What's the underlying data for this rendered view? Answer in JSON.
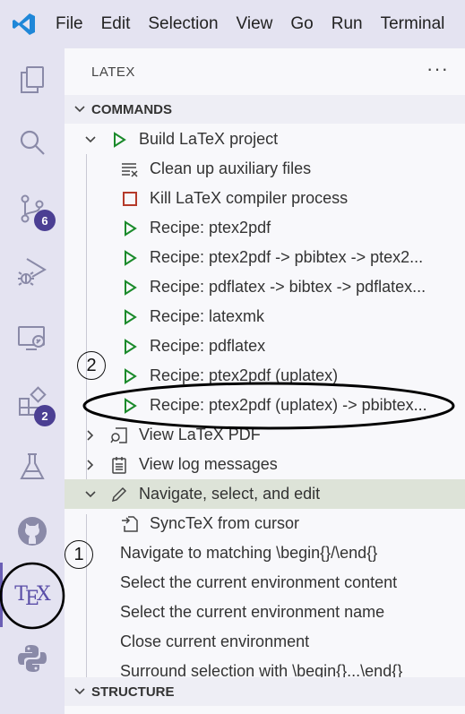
{
  "menubar": {
    "items": [
      "File",
      "Edit",
      "Selection",
      "View",
      "Go",
      "Run",
      "Terminal"
    ]
  },
  "activitybar": {
    "source_control_badge": "6",
    "extensions_badge": "2",
    "tex_label": "TEX"
  },
  "sidebar": {
    "title": "LATEX",
    "more": "···",
    "commands_header": "COMMANDS",
    "structure_header": "STRUCTURE",
    "items": [
      {
        "label": "Build LaTeX project"
      },
      {
        "label": "Clean up auxiliary files"
      },
      {
        "label": "Kill LaTeX compiler process"
      },
      {
        "label": "Recipe: ptex2pdf"
      },
      {
        "label": "Recipe: ptex2pdf -> pbibtex -> ptex2..."
      },
      {
        "label": "Recipe: pdflatex -> bibtex -> pdflatex..."
      },
      {
        "label": "Recipe: latexmk"
      },
      {
        "label": "Recipe: pdflatex"
      },
      {
        "label": "Recipe: ptex2pdf (uplatex)"
      },
      {
        "label": "Recipe: ptex2pdf (uplatex) -> pbibtex..."
      },
      {
        "label": "View LaTeX PDF"
      },
      {
        "label": "View log messages"
      },
      {
        "label": "Navigate, select, and edit"
      },
      {
        "label": "SyncTeX from cursor"
      },
      {
        "label": "Navigate to matching \\begin{}/\\end{}"
      },
      {
        "label": "Select the current environment content"
      },
      {
        "label": "Select the current environment name"
      },
      {
        "label": "Close current environment"
      },
      {
        "label": "Surround selection with \\begin{}...\\end{}"
      }
    ]
  },
  "annotations": {
    "marker_1": "①",
    "marker_2": "②"
  },
  "colors": {
    "activity_bg": "#e4e3f1",
    "accent": "#5a4ea8",
    "play_green": "#1a8a2a",
    "stop_red": "#b53a2a",
    "selected_row": "#dde3d8"
  }
}
